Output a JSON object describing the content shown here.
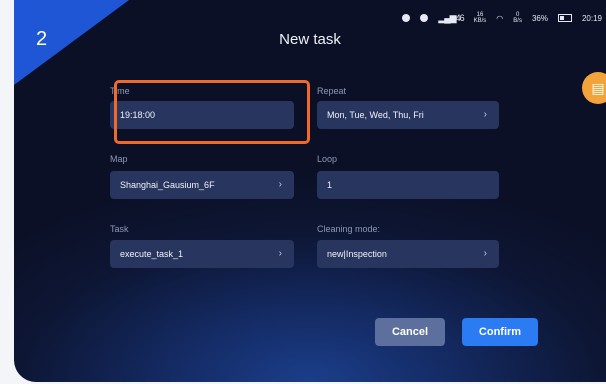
{
  "step_number": "2",
  "status_bar": {
    "net1": "46",
    "net2": "16",
    "net2_unit": "KB/s",
    "wifi_speed": "0",
    "wifi_unit": "B/s",
    "battery": "36%",
    "time": "20:19"
  },
  "title": "New task",
  "form": {
    "time_label": "Time",
    "time_value": "19:18:00",
    "repeat_label": "Repeat",
    "repeat_value": "Mon, Tue, Wed, Thu, Fri",
    "map_label": "Map",
    "map_value": "Shanghai_Gausium_6F",
    "loop_label": "Loop",
    "loop_value": "1",
    "task_label": "Task",
    "task_value": "execute_task_1",
    "cleaning_label": "Cleaning mode:",
    "cleaning_value": "new|Inspection"
  },
  "buttons": {
    "cancel": "Cancel",
    "confirm": "Confirm"
  },
  "icons": {
    "chevron": "›",
    "book": "manual-book-icon"
  },
  "colors": {
    "highlight": "#f26a2a",
    "confirm": "#2b7cf3",
    "corner": "#1e56d6"
  }
}
